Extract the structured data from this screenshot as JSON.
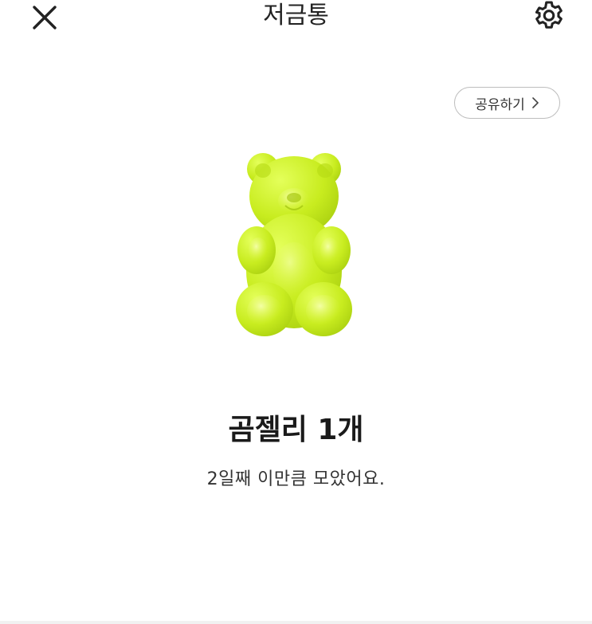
{
  "header": {
    "title": "저금통",
    "close_icon": "close-icon",
    "settings_icon": "gear-icon"
  },
  "share": {
    "label": "공유하기",
    "icon": "chevron-right-icon"
  },
  "piggy": {
    "image": "gummy-bear-icon",
    "bear_color": "#c6ea1c",
    "amount_text": "곰젤리 1개",
    "subtitle": "2일째 이만큼 모았어요."
  }
}
